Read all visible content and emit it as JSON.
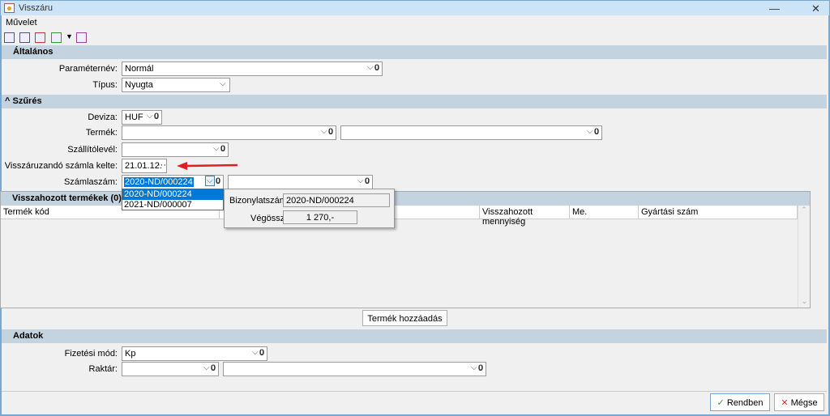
{
  "window": {
    "title": "Visszáru",
    "minimize": "—",
    "close": "✕"
  },
  "menu": {
    "item": "Művelet"
  },
  "toolbar": {
    "icons": [
      "edit-list-icon",
      "insert-row-icon",
      "delete-row-icon",
      "add-list-icon",
      "dropdown-arrow-icon",
      "report-icon"
    ]
  },
  "general": {
    "title": "Általános",
    "param_label": "Paraméternév:",
    "param_value": "Normál",
    "type_label": "Típus:",
    "type_value": "Nyugta"
  },
  "filter": {
    "title": "Szűrés",
    "toggle": "^",
    "currency_label": "Deviza:",
    "currency_value": "HUF",
    "product_label": "Termék:",
    "product_value": "",
    "product_value2": "",
    "delivery_label": "Szállítólevél:",
    "delivery_value": "",
    "date_label": "Visszáruzandó számla kelte:",
    "date_value": "21.01.12.",
    "date_button": "···",
    "invoice_label": "Számlaszám:",
    "invoice_value": "2020-ND/000224",
    "invoice_value2": "",
    "invoice_options": [
      "2020-ND/000224",
      "2021-ND/000007"
    ]
  },
  "tooltip": {
    "doc_label": "Bizonylatszám:",
    "doc_value": "2020-ND/000224",
    "total_label": "Végösszeg:",
    "total_value": "1 270,-"
  },
  "products": {
    "title": "Visszahozott termékek (0)",
    "columns": [
      "Termék kód",
      "",
      "Visszahozott mennyiség",
      "Me.",
      "Gyártási szám"
    ],
    "add_button": "Termék hozzáadás"
  },
  "data": {
    "title": "Adatok",
    "payment_label": "Fizetési mód:",
    "payment_value": "Kp",
    "warehouse_label": "Raktár:",
    "warehouse_value": "",
    "warehouse_value2": ""
  },
  "footer": {
    "ok": "Rendben",
    "cancel": "Mégse"
  },
  "colors": {
    "section": "#c4d3e0",
    "titlebar": "#cde4f7",
    "selection": "#0078d7",
    "arrow": "#e02020"
  }
}
